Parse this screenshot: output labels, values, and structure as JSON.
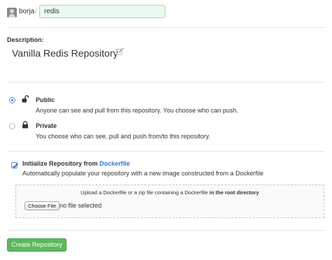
{
  "header": {
    "owner": "borja",
    "separator": "/",
    "repo_name": "redis"
  },
  "description": {
    "label": "Description:",
    "value": "Vanilla Redis Repository"
  },
  "visibility": {
    "selected": "public",
    "options": [
      {
        "key": "public",
        "title": "Public",
        "description": "Anyone can see and pull from this repository. You choose who can push.",
        "icon": "unlock-icon"
      },
      {
        "key": "private",
        "title": "Private",
        "description": "You choose who can see, pull and push from/to this repository.",
        "icon": "lock-icon"
      }
    ]
  },
  "initialize": {
    "checked": true,
    "title_prefix": "Initialize Repository from ",
    "title_link": "Dockerfile",
    "description": "Automatically populate your repository with a new image constructed from a Dockerfile",
    "upload_text_prefix": "Upload a Dockerfile or a zip file containing a Dockerfile ",
    "upload_text_bold": "in the root directory",
    "choose_file_label": "Choose File",
    "file_status": "no file selected"
  },
  "actions": {
    "create_label": "Create Repository"
  },
  "colors": {
    "accent_green": "#5cb85c",
    "link_blue": "#2f7ad0",
    "input_bg": "#e9fbee"
  }
}
